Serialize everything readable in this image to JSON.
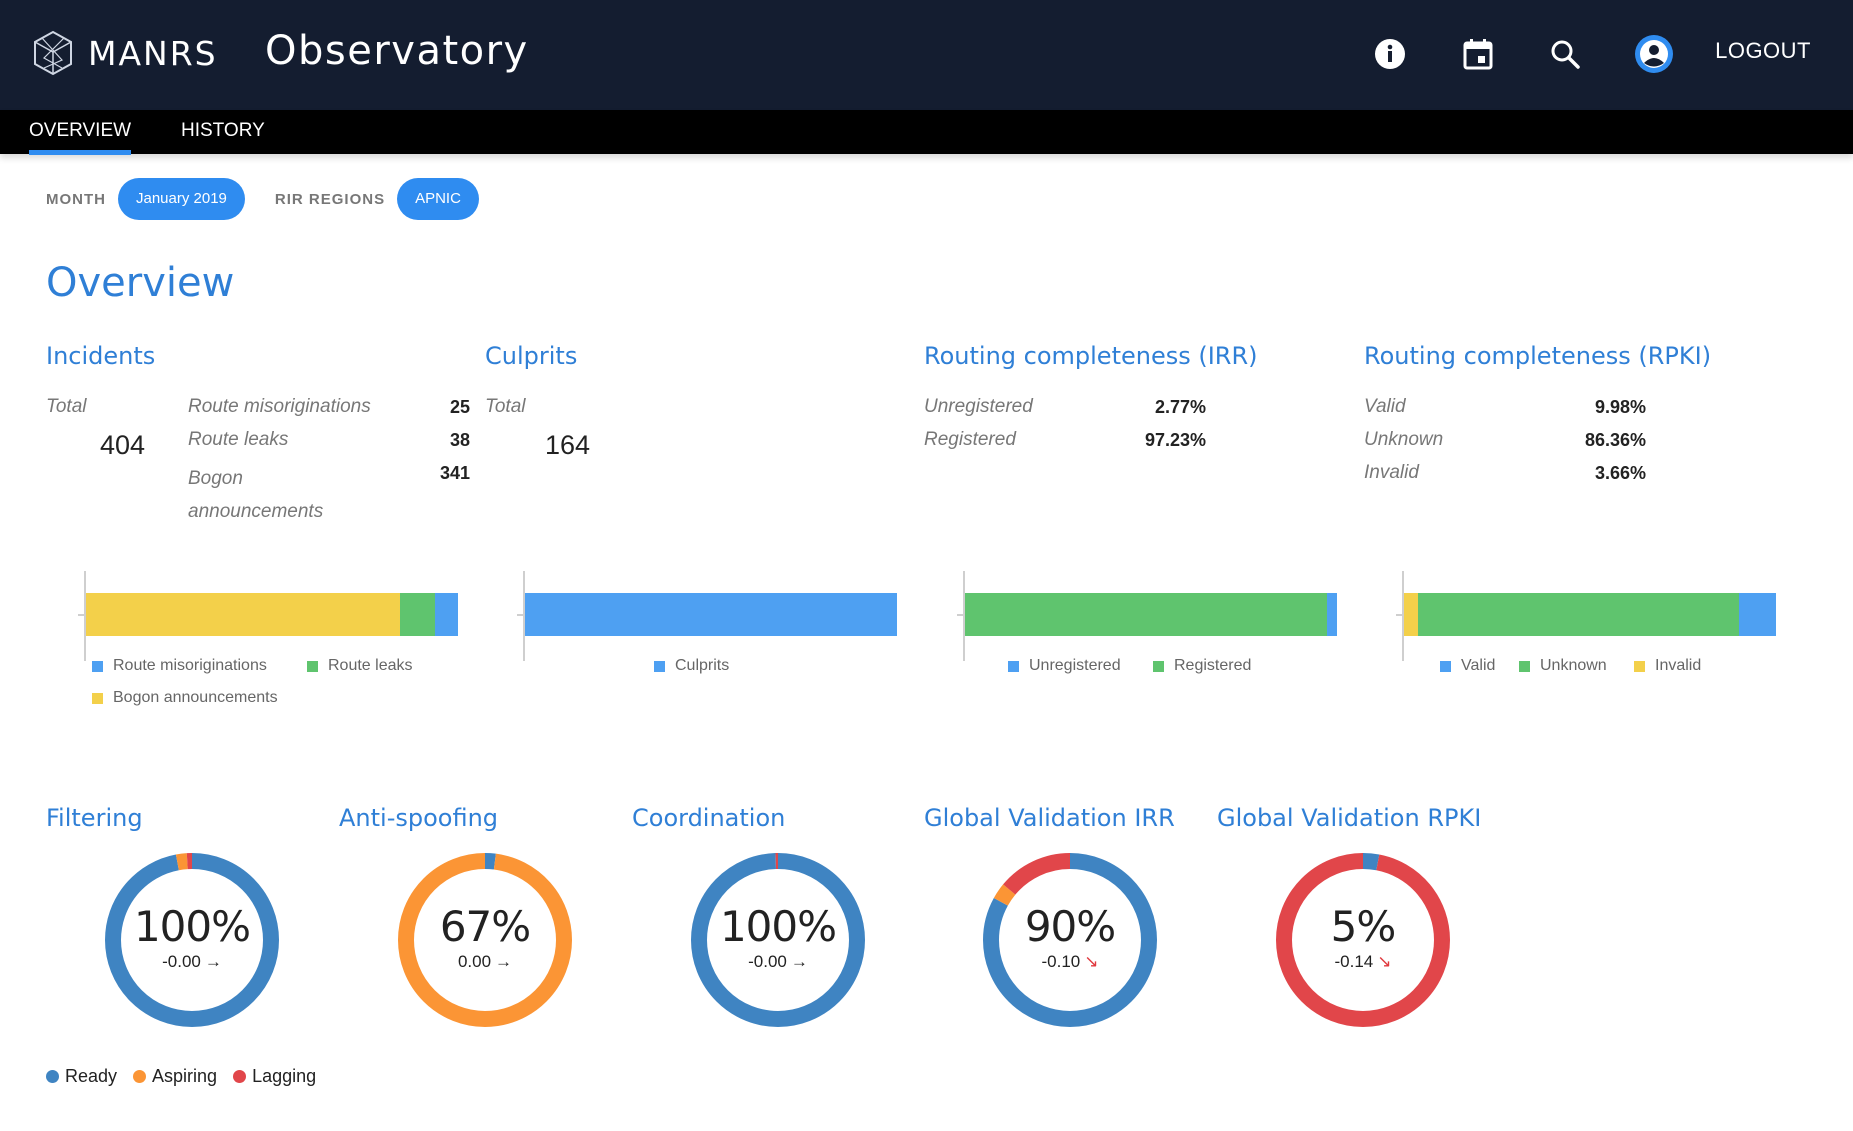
{
  "header": {
    "brand": "MANRS",
    "title": "Observatory",
    "logout_label": "LOGOUT"
  },
  "tabs": [
    {
      "label": "OVERVIEW",
      "active": true
    },
    {
      "label": "HISTORY",
      "active": false
    }
  ],
  "filters": {
    "month_label": "MONTH",
    "month_value": "January 2019",
    "region_label": "RIR REGIONS",
    "region_value": "APNIC"
  },
  "page_title": "Overview",
  "colors": {
    "blue": "#4ea0f2",
    "green": "#5fc46e",
    "yellow": "#f3d04a",
    "ready": "#3f84c2",
    "aspiring": "#fb9535",
    "lagging": "#e1464a"
  },
  "incidents": {
    "title": "Incidents",
    "total_label": "Total",
    "total_value": "404",
    "rows": [
      {
        "label": "Route misoriginations",
        "value": "25"
      },
      {
        "label": "Route leaks",
        "value": "38"
      },
      {
        "label": "Bogon announcements",
        "value": "341"
      }
    ],
    "legend": [
      "Route misoriginations",
      "Route leaks",
      "Bogon announcements"
    ]
  },
  "culprits": {
    "title": "Culprits",
    "total_label": "Total",
    "total_value": "164",
    "legend": [
      "Culprits"
    ]
  },
  "irr": {
    "title": "Routing completeness (IRR)",
    "rows": [
      {
        "label": "Unregistered",
        "value": "2.77%"
      },
      {
        "label": "Registered",
        "value": "97.23%"
      }
    ],
    "legend": [
      "Unregistered",
      "Registered"
    ]
  },
  "rpki": {
    "title": "Routing completeness (RPKI)",
    "rows": [
      {
        "label": "Valid",
        "value": "9.98%"
      },
      {
        "label": "Unknown",
        "value": "86.36%"
      },
      {
        "label": "Invalid",
        "value": "3.66%"
      }
    ],
    "legend": [
      "Valid",
      "Unknown",
      "Invalid"
    ]
  },
  "scores": [
    {
      "title": "Filtering",
      "pct": "100%",
      "delta": "-0.00",
      "trend": "flat",
      "ready": 97,
      "aspiring": 2,
      "lagging": 1
    },
    {
      "title": "Anti-spoofing",
      "pct": "67%",
      "delta": "0.00",
      "trend": "flat",
      "ready": 2,
      "aspiring": 98,
      "lagging": 0
    },
    {
      "title": "Coordination",
      "pct": "100%",
      "delta": "-0.00",
      "trend": "flat",
      "ready": 99.5,
      "aspiring": 0,
      "lagging": 0.5
    },
    {
      "title": "Global Validation IRR",
      "pct": "90%",
      "delta": "-0.10",
      "trend": "down",
      "ready": 83,
      "aspiring": 3,
      "lagging": 14
    },
    {
      "title": "Global Validation RPKI",
      "pct": "5%",
      "delta": "-0.14",
      "trend": "down",
      "ready": 3,
      "aspiring": 0,
      "lagging": 97
    }
  ],
  "score_legend": [
    "Ready",
    "Aspiring",
    "Lagging"
  ],
  "chart_data": [
    {
      "type": "bar",
      "orientation": "horizontal",
      "stacked": true,
      "categories": [
        "Incidents"
      ],
      "series": [
        {
          "name": "Bogon announcements",
          "values": [
            341
          ]
        },
        {
          "name": "Route leaks",
          "values": [
            38
          ]
        },
        {
          "name": "Route misoriginations",
          "values": [
            25
          ]
        }
      ]
    },
    {
      "type": "bar",
      "orientation": "horizontal",
      "stacked": true,
      "categories": [
        "Culprits"
      ],
      "series": [
        {
          "name": "Culprits",
          "values": [
            164
          ]
        }
      ]
    },
    {
      "type": "bar",
      "orientation": "horizontal",
      "stacked": true,
      "categories": [
        "IRR"
      ],
      "series": [
        {
          "name": "Registered",
          "values": [
            97.23
          ]
        },
        {
          "name": "Unregistered",
          "values": [
            2.77
          ]
        }
      ]
    },
    {
      "type": "bar",
      "orientation": "horizontal",
      "stacked": true,
      "categories": [
        "RPKI"
      ],
      "series": [
        {
          "name": "Invalid",
          "values": [
            3.66
          ]
        },
        {
          "name": "Unknown",
          "values": [
            86.36
          ]
        },
        {
          "name": "Valid",
          "values": [
            9.98
          ]
        }
      ]
    },
    {
      "type": "pie",
      "title": "Filtering",
      "categories": [
        "Ready",
        "Aspiring",
        "Lagging"
      ],
      "values": [
        97,
        2,
        1
      ]
    },
    {
      "type": "pie",
      "title": "Anti-spoofing",
      "categories": [
        "Ready",
        "Aspiring",
        "Lagging"
      ],
      "values": [
        2,
        98,
        0
      ]
    },
    {
      "type": "pie",
      "title": "Coordination",
      "categories": [
        "Ready",
        "Aspiring",
        "Lagging"
      ],
      "values": [
        99.5,
        0,
        0.5
      ]
    },
    {
      "type": "pie",
      "title": "Global Validation IRR",
      "categories": [
        "Ready",
        "Aspiring",
        "Lagging"
      ],
      "values": [
        83,
        3,
        14
      ]
    },
    {
      "type": "pie",
      "title": "Global Validation RPKI",
      "categories": [
        "Ready",
        "Aspiring",
        "Lagging"
      ],
      "values": [
        3,
        0,
        97
      ]
    }
  ]
}
